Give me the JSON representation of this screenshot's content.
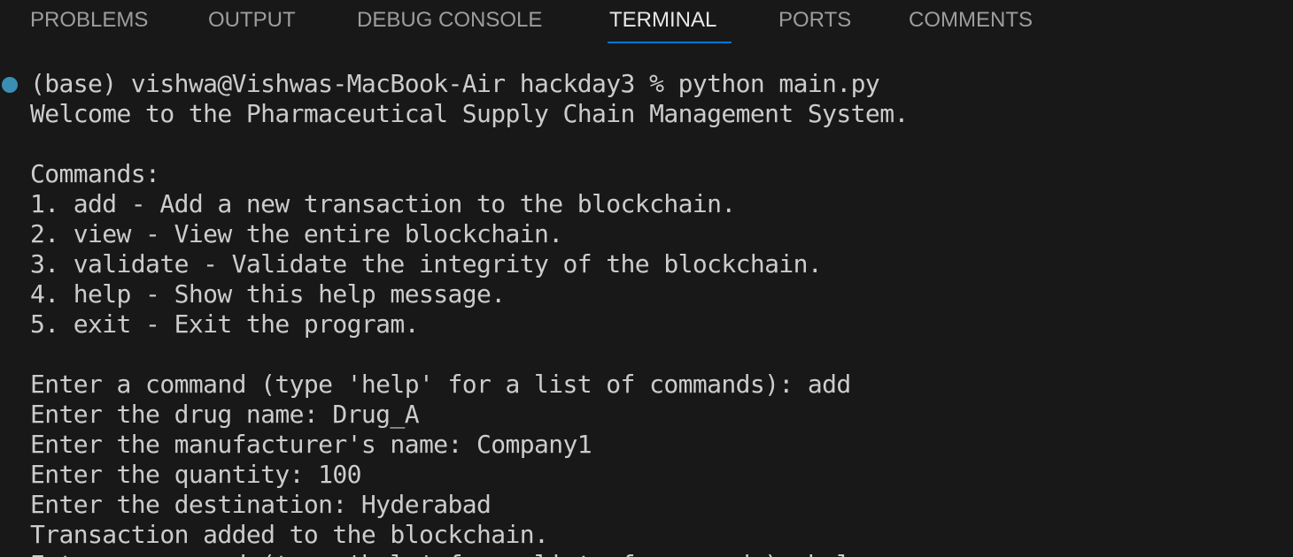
{
  "panel": {
    "tabs": [
      {
        "label": "PROBLEMS"
      },
      {
        "label": "OUTPUT"
      },
      {
        "label": "DEBUG CONSOLE"
      },
      {
        "label": "TERMINAL",
        "active": true
      },
      {
        "label": "PORTS"
      },
      {
        "label": "COMMENTS"
      }
    ]
  },
  "terminal": {
    "lines": [
      "(base) vishwa@Vishwas-MacBook-Air hackday3 % python main.py",
      "Welcome to the Pharmaceutical Supply Chain Management System.",
      "",
      "Commands:",
      "1. add - Add a new transaction to the blockchain.",
      "2. view - View the entire blockchain.",
      "3. validate - Validate the integrity of the blockchain.",
      "4. help - Show this help message.",
      "5. exit - Exit the program.",
      "",
      "Enter a command (type 'help' for a list of commands): add",
      "Enter the drug name: Drug_A",
      "Enter the manufacturer's name: Company1",
      "Enter the quantity: 100",
      "Enter the destination: Hyderabad",
      "Transaction added to the blockchain.",
      "Enter a command (type 'help' for a list of commands): help"
    ],
    "colors": {
      "background": "#181818",
      "text": "#cccccc",
      "status_dot": "#3b8eb3",
      "active_tab_underline": "#0078d4"
    }
  }
}
